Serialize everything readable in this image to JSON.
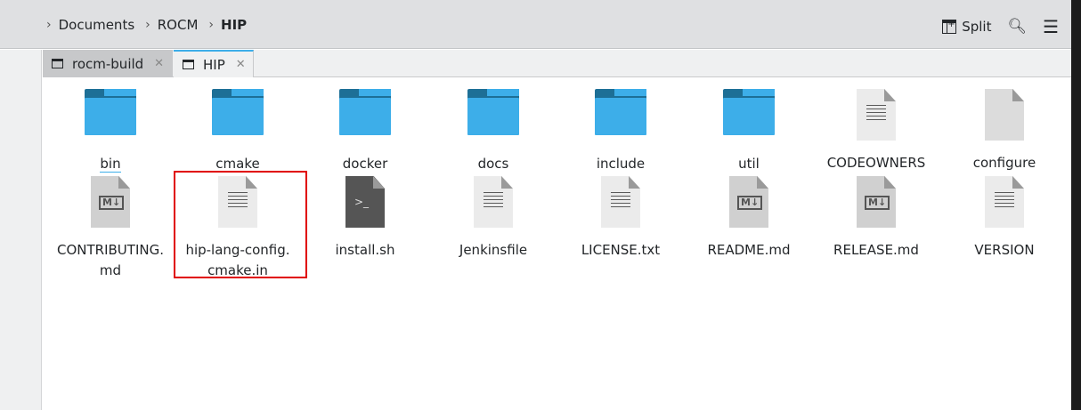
{
  "breadcrumb": [
    "Documents",
    "ROCM",
    "HIP"
  ],
  "toolbar": {
    "split_label": "Split"
  },
  "tabs": [
    {
      "label": "rocm-build"
    },
    {
      "label": "HIP"
    }
  ],
  "items": [
    {
      "name": "bin",
      "type": "folder"
    },
    {
      "name": "cmake",
      "type": "folder"
    },
    {
      "name": "docker",
      "type": "folder"
    },
    {
      "name": "docs",
      "type": "folder"
    },
    {
      "name": "include",
      "type": "folder"
    },
    {
      "name": "util",
      "type": "folder"
    },
    {
      "name": "CODEOWNERS",
      "type": "text"
    },
    {
      "name": "configure",
      "type": "plain"
    },
    {
      "name": "CONTRIBUTING.\nmd",
      "type": "markdown"
    },
    {
      "name": "hip-lang-config.\ncmake.in",
      "type": "text"
    },
    {
      "name": "install.sh",
      "type": "shell"
    },
    {
      "name": "Jenkinsfile",
      "type": "text"
    },
    {
      "name": "LICENSE.txt",
      "type": "text"
    },
    {
      "name": "README.md",
      "type": "markdown"
    },
    {
      "name": "RELEASE.md",
      "type": "markdown"
    },
    {
      "name": "VERSION",
      "type": "text"
    }
  ],
  "icons": {
    "markdown_glyph": "M↓",
    "shell_glyph": ">_"
  }
}
